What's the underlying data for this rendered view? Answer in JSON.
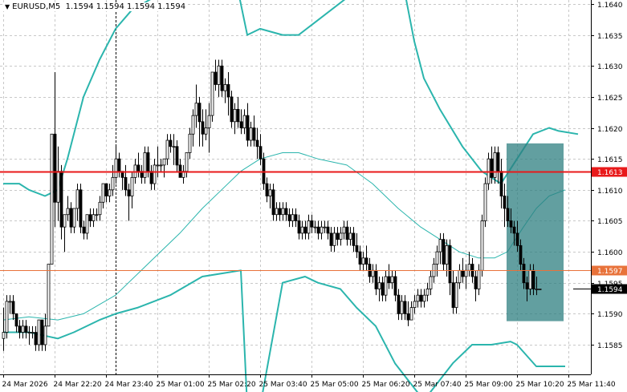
{
  "header": {
    "symbol_timeframe": "EURUSD,M5",
    "ohlc": "1.1594 1.1594 1.1594 1.1594",
    "dropdown_glyph": "▼"
  },
  "chart_data": {
    "type": "candlestick",
    "ylim": [
      1.15815,
      1.16405
    ],
    "grid": true,
    "y_ticks": [
      "1.1640",
      "1.1635",
      "1.1630",
      "1.1625",
      "1.1620",
      "1.1615",
      "1.1610",
      "1.1605",
      "1.1600",
      "1.1595",
      "1.1590",
      "1.1585"
    ],
    "x_ticks": [
      "24 Mar 2026",
      "24 Mar 22:20",
      "24 Mar 23:40",
      "25 Mar 01:00",
      "25 Mar 02:20",
      "25 Mar 03:40",
      "25 Mar 05:00",
      "25 Mar 06:20",
      "25 Mar 07:40",
      "25 Mar 09:00",
      "25 Mar 10:20",
      "25 Mar 11:40"
    ],
    "bar_count": 176,
    "current_price": "1.1594",
    "levels": [
      {
        "label": "1.1613",
        "value": 1.1613,
        "color": "#e8191a"
      },
      {
        "label": "1.1597",
        "value": 1.1597,
        "color": "#e8723a"
      }
    ],
    "highlight_zone": {
      "from_bar": 157,
      "to_bar": 174,
      "price_low": 1.15888,
      "price_high": 1.16175,
      "color": "#2e7f80"
    },
    "vertical_marker_bar": 35,
    "bollinger_upper": [
      [
        0,
        1.1611
      ],
      [
        5,
        1.1611
      ],
      [
        8,
        1.161
      ],
      [
        13,
        1.1609
      ],
      [
        17,
        1.161
      ],
      [
        20,
        1.1615
      ],
      [
        25,
        1.1625
      ],
      [
        30,
        1.1631
      ],
      [
        35,
        1.1636
      ],
      [
        40,
        1.1639
      ],
      [
        50,
        1.1642
      ],
      [
        60,
        1.1645
      ],
      [
        66,
        1.1649
      ],
      [
        72,
        1.1645
      ],
      [
        76,
        1.1635
      ],
      [
        80,
        1.1636
      ],
      [
        87,
        1.1635
      ],
      [
        92,
        1.1635
      ],
      [
        97,
        1.1637
      ],
      [
        107,
        1.1641
      ],
      [
        115,
        1.1643
      ],
      [
        121,
        1.1644
      ],
      [
        125,
        1.1642
      ],
      [
        128,
        1.1634
      ],
      [
        131,
        1.1628
      ],
      [
        136,
        1.1623
      ],
      [
        143,
        1.1617
      ],
      [
        149,
        1.1613
      ],
      [
        155,
        1.1611
      ],
      [
        160,
        1.1615
      ],
      [
        165,
        1.1619
      ],
      [
        170,
        1.162
      ],
      [
        173,
        1.16195
      ],
      [
        179,
        1.1619
      ]
    ],
    "bollinger_middle": [
      [
        0,
        1.1589
      ],
      [
        8,
        1.15895
      ],
      [
        17,
        1.1589
      ],
      [
        25,
        1.159
      ],
      [
        35,
        1.1593
      ],
      [
        45,
        1.1598
      ],
      [
        55,
        1.1603
      ],
      [
        62,
        1.1607
      ],
      [
        68,
        1.161
      ],
      [
        74,
        1.1613
      ],
      [
        80,
        1.1615
      ],
      [
        87,
        1.1616
      ],
      [
        92,
        1.1616
      ],
      [
        98,
        1.1615
      ],
      [
        107,
        1.1614
      ],
      [
        115,
        1.1611
      ],
      [
        123,
        1.1607
      ],
      [
        130,
        1.1604
      ],
      [
        136,
        1.1602
      ],
      [
        142,
        1.16
      ],
      [
        148,
        1.1599
      ],
      [
        153,
        1.1599
      ],
      [
        157,
        1.16
      ],
      [
        162,
        1.1604
      ],
      [
        166,
        1.1607
      ],
      [
        170,
        1.1609
      ],
      [
        175,
        1.161
      ]
    ],
    "bollinger_lower": [
      [
        0,
        1.1587
      ],
      [
        8,
        1.1587
      ],
      [
        17,
        1.1586
      ],
      [
        22,
        1.1587
      ],
      [
        30,
        1.1589
      ],
      [
        35,
        1.159
      ],
      [
        42,
        1.1591
      ],
      [
        52,
        1.1593
      ],
      [
        62,
        1.1596
      ],
      [
        74,
        1.1597
      ],
      [
        76,
        1.1575
      ],
      [
        80,
        1.1575
      ],
      [
        87,
        1.1595
      ],
      [
        94,
        1.1596
      ],
      [
        98,
        1.1595
      ],
      [
        105,
        1.1594
      ],
      [
        110,
        1.1591
      ],
      [
        116,
        1.1588
      ],
      [
        122,
        1.1582
      ],
      [
        128,
        1.1578
      ],
      [
        131,
        1.1576
      ],
      [
        140,
        1.1582
      ],
      [
        146,
        1.1585
      ],
      [
        152,
        1.1585
      ],
      [
        158,
        1.15855
      ],
      [
        160,
        1.1585
      ],
      [
        166,
        1.15815
      ],
      [
        175,
        1.15815
      ]
    ],
    "candles_ohlc": [
      [
        1.1586,
        1.1591,
        1.1584,
        1.1587
      ],
      [
        1.1587,
        1.1593,
        1.1586,
        1.1592
      ],
      [
        1.1592,
        1.1593,
        1.159,
        1.1592
      ],
      [
        1.1592,
        1.1593,
        1.1589,
        1.159
      ],
      [
        1.159,
        1.159,
        1.1587,
        1.1588
      ],
      [
        1.1588,
        1.1589,
        1.1586,
        1.1587
      ],
      [
        1.1587,
        1.1589,
        1.1586,
        1.1588
      ],
      [
        1.1588,
        1.1589,
        1.1586,
        1.1587
      ],
      [
        1.1587,
        1.1588,
        1.1585,
        1.1587
      ],
      [
        1.1587,
        1.1588,
        1.1586,
        1.1587
      ],
      [
        1.1587,
        1.1588,
        1.1584,
        1.1585
      ],
      [
        1.1585,
        1.1589,
        1.1584,
        1.1589
      ],
      [
        1.1589,
        1.1589,
        1.1584,
        1.1585
      ],
      [
        1.1585,
        1.159,
        1.1584,
        1.1588
      ],
      [
        1.1588,
        1.1598,
        1.1588,
        1.1598
      ],
      [
        1.1598,
        1.1619,
        1.1598,
        1.1619
      ],
      [
        1.1619,
        1.1629,
        1.1604,
        1.1608
      ],
      [
        1.1608,
        1.1617,
        1.1605,
        1.1613
      ],
      [
        1.1613,
        1.1614,
        1.1602,
        1.1604
      ],
      [
        1.1604,
        1.1606,
        1.16,
        1.1606
      ],
      [
        1.1606,
        1.1609,
        1.1605,
        1.1607
      ],
      [
        1.1607,
        1.1608,
        1.1603,
        1.1604
      ],
      [
        1.1604,
        1.1607,
        1.1603,
        1.1607
      ],
      [
        1.1607,
        1.1611,
        1.1605,
        1.161
      ],
      [
        1.161,
        1.1611,
        1.1603,
        1.1604
      ],
      [
        1.1604,
        1.1605,
        1.1602,
        1.1603
      ],
      [
        1.1603,
        1.1606,
        1.1602,
        1.1606
      ],
      [
        1.1606,
        1.1607,
        1.1604,
        1.1605
      ],
      [
        1.1605,
        1.1607,
        1.1604,
        1.1606
      ],
      [
        1.1606,
        1.1607,
        1.1605,
        1.1606
      ],
      [
        1.1606,
        1.1609,
        1.1605,
        1.1608
      ],
      [
        1.1608,
        1.1611,
        1.1607,
        1.1611
      ],
      [
        1.1611,
        1.1611,
        1.1608,
        1.1609
      ],
      [
        1.1609,
        1.1611,
        1.1608,
        1.161
      ],
      [
        1.161,
        1.1614,
        1.1609,
        1.1612
      ],
      [
        1.1612,
        1.1617,
        1.1611,
        1.1615
      ],
      [
        1.1615,
        1.1616,
        1.1612,
        1.1613
      ],
      [
        1.1613,
        1.1613,
        1.161,
        1.1612
      ],
      [
        1.1612,
        1.1614,
        1.1609,
        1.161
      ],
      [
        1.161,
        1.1611,
        1.1605,
        1.1609
      ],
      [
        1.1609,
        1.1613,
        1.1607,
        1.1612
      ],
      [
        1.1612,
        1.1615,
        1.1611,
        1.1614
      ],
      [
        1.1614,
        1.1616,
        1.1612,
        1.1613
      ],
      [
        1.1613,
        1.1614,
        1.1611,
        1.1612
      ],
      [
        1.1612,
        1.1617,
        1.1611,
        1.1616
      ],
      [
        1.1616,
        1.1617,
        1.1612,
        1.1613
      ],
      [
        1.1613,
        1.1614,
        1.161,
        1.1611
      ],
      [
        1.1611,
        1.1615,
        1.161,
        1.1614
      ],
      [
        1.1614,
        1.1617,
        1.1612,
        1.1614
      ],
      [
        1.1614,
        1.1615,
        1.1613,
        1.1614
      ],
      [
        1.1614,
        1.1615,
        1.1612,
        1.1615
      ],
      [
        1.1615,
        1.1619,
        1.1614,
        1.1618
      ],
      [
        1.1618,
        1.1619,
        1.1616,
        1.1617
      ],
      [
        1.1617,
        1.1619,
        1.1614,
        1.1617
      ],
      [
        1.1617,
        1.1618,
        1.1613,
        1.1614
      ],
      [
        1.1614,
        1.1615,
        1.1612,
        1.1612
      ],
      [
        1.1612,
        1.1614,
        1.1611,
        1.1613
      ],
      [
        1.1613,
        1.1616,
        1.1612,
        1.1616
      ],
      [
        1.1616,
        1.162,
        1.1615,
        1.1619
      ],
      [
        1.1619,
        1.1623,
        1.1617,
        1.1622
      ],
      [
        1.1622,
        1.1627,
        1.162,
        1.1624
      ],
      [
        1.1624,
        1.1625,
        1.1617,
        1.1621
      ],
      [
        1.1621,
        1.1623,
        1.1617,
        1.1619
      ],
      [
        1.1619,
        1.1623,
        1.1618,
        1.162
      ],
      [
        1.162,
        1.1624,
        1.1616,
        1.1622
      ],
      [
        1.1622,
        1.1629,
        1.1621,
        1.1629
      ],
      [
        1.1629,
        1.1631,
        1.1626,
        1.1627
      ],
      [
        1.1627,
        1.1631,
        1.1625,
        1.163
      ],
      [
        1.163,
        1.1631,
        1.1625,
        1.1626
      ],
      [
        1.1626,
        1.1628,
        1.1624,
        1.1627
      ],
      [
        1.1627,
        1.1629,
        1.1622,
        1.1625
      ],
      [
        1.1625,
        1.1626,
        1.162,
        1.1621
      ],
      [
        1.1621,
        1.1624,
        1.1619,
        1.1623
      ],
      [
        1.1623,
        1.1625,
        1.162,
        1.1621
      ],
      [
        1.1621,
        1.1623,
        1.1619,
        1.162
      ],
      [
        1.162,
        1.1623,
        1.1619,
        1.1622
      ],
      [
        1.1622,
        1.1624,
        1.1617,
        1.1618
      ],
      [
        1.1618,
        1.1621,
        1.1617,
        1.162
      ],
      [
        1.162,
        1.1622,
        1.1617,
        1.1618
      ],
      [
        1.1618,
        1.162,
        1.1615,
        1.1617
      ],
      [
        1.1617,
        1.1619,
        1.1614,
        1.1615
      ],
      [
        1.1615,
        1.1616,
        1.161,
        1.1611
      ],
      [
        1.1611,
        1.1612,
        1.1608,
        1.1609
      ],
      [
        1.1609,
        1.1611,
        1.1607,
        1.161
      ],
      [
        1.161,
        1.1611,
        1.1605,
        1.1606
      ],
      [
        1.1606,
        1.1608,
        1.1605,
        1.1607
      ],
      [
        1.1607,
        1.1608,
        1.1605,
        1.1606
      ],
      [
        1.1606,
        1.1608,
        1.1605,
        1.1607
      ],
      [
        1.1607,
        1.1608,
        1.1605,
        1.1606
      ],
      [
        1.1606,
        1.1607,
        1.1604,
        1.1605
      ],
      [
        1.1605,
        1.1607,
        1.1604,
        1.1606
      ],
      [
        1.1606,
        1.1607,
        1.1604,
        1.1605
      ],
      [
        1.1605,
        1.1606,
        1.1602,
        1.1603
      ],
      [
        1.1603,
        1.1605,
        1.1602,
        1.1604
      ],
      [
        1.1604,
        1.1605,
        1.1602,
        1.1603
      ],
      [
        1.1603,
        1.1606,
        1.1602,
        1.1605
      ],
      [
        1.1605,
        1.1606,
        1.1603,
        1.1604
      ],
      [
        1.1604,
        1.1605,
        1.1603,
        1.1604
      ],
      [
        1.1604,
        1.1605,
        1.1602,
        1.1603
      ],
      [
        1.1603,
        1.1605,
        1.1602,
        1.1604
      ],
      [
        1.1604,
        1.1605,
        1.1603,
        1.1604
      ],
      [
        1.1604,
        1.1605,
        1.1602,
        1.1603
      ],
      [
        1.1603,
        1.1604,
        1.16,
        1.1601
      ],
      [
        1.1601,
        1.1604,
        1.16,
        1.1603
      ],
      [
        1.1603,
        1.1604,
        1.1601,
        1.1602
      ],
      [
        1.1602,
        1.1604,
        1.1601,
        1.1603
      ],
      [
        1.1603,
        1.1605,
        1.1602,
        1.1604
      ],
      [
        1.1604,
        1.1605,
        1.1601,
        1.1602
      ],
      [
        1.1602,
        1.1604,
        1.1601,
        1.1603
      ],
      [
        1.1603,
        1.1604,
        1.16,
        1.1601
      ],
      [
        1.1601,
        1.1603,
        1.1599,
        1.16
      ],
      [
        1.16,
        1.1601,
        1.1597,
        1.1598
      ],
      [
        1.1598,
        1.16,
        1.1597,
        1.1599
      ],
      [
        1.1599,
        1.1601,
        1.1597,
        1.1598
      ],
      [
        1.1598,
        1.1599,
        1.1595,
        1.1596
      ],
      [
        1.1596,
        1.1598,
        1.1595,
        1.1597
      ],
      [
        1.1597,
        1.1598,
        1.1593,
        1.1594
      ],
      [
        1.1594,
        1.1596,
        1.1592,
        1.1595
      ],
      [
        1.1595,
        1.1596,
        1.1592,
        1.1593
      ],
      [
        1.1593,
        1.1597,
        1.1592,
        1.1596
      ],
      [
        1.1596,
        1.1598,
        1.1594,
        1.1595
      ],
      [
        1.1595,
        1.1597,
        1.1594,
        1.1596
      ],
      [
        1.1596,
        1.1597,
        1.1592,
        1.1593
      ],
      [
        1.1593,
        1.1594,
        1.1589,
        1.159
      ],
      [
        1.159,
        1.1593,
        1.1589,
        1.1592
      ],
      [
        1.1592,
        1.1593,
        1.1589,
        1.159
      ],
      [
        1.159,
        1.1592,
        1.1588,
        1.1589
      ],
      [
        1.1589,
        1.1592,
        1.1589,
        1.1591
      ],
      [
        1.1591,
        1.1593,
        1.159,
        1.1592
      ],
      [
        1.1592,
        1.1594,
        1.1591,
        1.1593
      ],
      [
        1.1593,
        1.1594,
        1.1591,
        1.1592
      ],
      [
        1.1592,
        1.1594,
        1.1591,
        1.1593
      ],
      [
        1.1593,
        1.1595,
        1.1592,
        1.1594
      ],
      [
        1.1594,
        1.1597,
        1.1593,
        1.1596
      ],
      [
        1.1596,
        1.1599,
        1.1595,
        1.1598
      ],
      [
        1.1598,
        1.1601,
        1.1596,
        1.16
      ],
      [
        1.16,
        1.1603,
        1.1598,
        1.1602
      ],
      [
        1.1602,
        1.1603,
        1.1597,
        1.1598
      ],
      [
        1.1598,
        1.1602,
        1.1596,
        1.1601
      ],
      [
        1.1601,
        1.1602,
        1.1593,
        1.1595
      ],
      [
        1.1595,
        1.1597,
        1.159,
        1.1591
      ],
      [
        1.1591,
        1.1596,
        1.159,
        1.1595
      ],
      [
        1.1595,
        1.1598,
        1.1594,
        1.1597
      ],
      [
        1.1597,
        1.1599,
        1.1595,
        1.1596
      ],
      [
        1.1596,
        1.1598,
        1.1594,
        1.1597
      ],
      [
        1.1597,
        1.16,
        1.1596,
        1.1598
      ],
      [
        1.1598,
        1.1599,
        1.1595,
        1.1596
      ],
      [
        1.1596,
        1.1597,
        1.1592,
        1.1594
      ],
      [
        1.1594,
        1.1598,
        1.1593,
        1.1597
      ],
      [
        1.1597,
        1.1606,
        1.1596,
        1.1605
      ],
      [
        1.1605,
        1.1612,
        1.1604,
        1.1611
      ],
      [
        1.1611,
        1.1616,
        1.161,
        1.1615
      ],
      [
        1.1615,
        1.1617,
        1.1611,
        1.1612
      ],
      [
        1.1612,
        1.1617,
        1.1611,
        1.1616
      ],
      [
        1.1616,
        1.1617,
        1.1611,
        1.1613
      ],
      [
        1.1613,
        1.1615,
        1.1607,
        1.1609
      ],
      [
        1.1609,
        1.1611,
        1.1604,
        1.1607
      ],
      [
        1.1607,
        1.1609,
        1.1604,
        1.1605
      ],
      [
        1.1605,
        1.1607,
        1.1603,
        1.1604
      ],
      [
        1.1604,
        1.1605,
        1.1601,
        1.1603
      ],
      [
        1.1603,
        1.1605,
        1.16,
        1.1601
      ],
      [
        1.1601,
        1.1602,
        1.1597,
        1.1598
      ],
      [
        1.1598,
        1.1599,
        1.1594,
        1.1595
      ],
      [
        1.1595,
        1.1596,
        1.1592,
        1.1594
      ],
      [
        1.1594,
        1.1598,
        1.1593,
        1.1597
      ],
      [
        1.1597,
        1.1598,
        1.1593,
        1.1594
      ],
      [
        1.1594,
        1.1596,
        1.1593,
        1.1594
      ],
      [
        1.1594,
        1.1594,
        1.1594,
        1.1594
      ]
    ]
  }
}
